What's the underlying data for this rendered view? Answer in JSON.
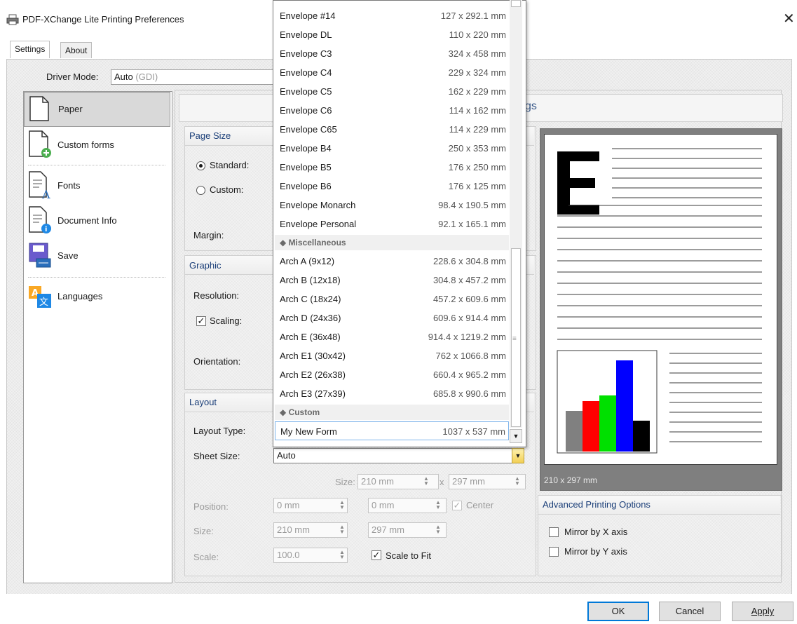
{
  "window": {
    "title": "PDF-XChange Lite Printing Preferences",
    "close": "✕"
  },
  "tabs": [
    "Settings",
    "About"
  ],
  "driver_mode": {
    "label": "Driver Mode:",
    "value": "Auto",
    "value_suffix": "(GDI)"
  },
  "sidebar": {
    "items": [
      {
        "label": "Paper",
        "icon": "paper-icon"
      },
      {
        "label": "Custom forms",
        "icon": "custom-forms-icon"
      },
      {
        "label": "Fonts",
        "icon": "fonts-icon"
      },
      {
        "label": "Document Info",
        "icon": "document-info-icon"
      },
      {
        "label": "Save",
        "icon": "save-icon"
      },
      {
        "label": "Languages",
        "icon": "languages-icon"
      }
    ]
  },
  "header_tail": "gs",
  "page_size": {
    "title": "Page Size",
    "standard_label": "Standard:",
    "custom_label": "Custom:",
    "margin_label": "Margin:"
  },
  "graphic": {
    "title": "Graphic",
    "resolution_label": "Resolution:",
    "scaling_label": "Scaling:",
    "orientation_label": "Orientation:"
  },
  "layout": {
    "title": "Layout",
    "layout_type_label": "Layout Type:",
    "sheet_size_label": "Sheet Size:",
    "sheet_size_value": "Auto",
    "size_label": "Size:",
    "size_w": "210 mm",
    "size_x": "x",
    "size_h": "297 mm",
    "position_label": "Position:",
    "position_x": "0 mm",
    "position_y": "0 mm",
    "center_label": "Center",
    "size2_label": "Size:",
    "size2_w": "210 mm",
    "size2_h": "297 mm",
    "scale_label": "Scale:",
    "scale_value": "100.0",
    "scale_to_fit_label": "Scale to Fit"
  },
  "preview": {
    "caption": "210 x 297 mm"
  },
  "advanced": {
    "title": "Advanced Printing Options",
    "mirror_x": "Mirror by X axis",
    "mirror_y": "Mirror by Y axis"
  },
  "buttons": {
    "ok": "OK",
    "cancel": "Cancel",
    "apply": "Apply"
  },
  "dropdown": {
    "items_top": [
      {
        "name": "Envelope #14",
        "size": "127 x 292.1 mm"
      },
      {
        "name": "Envelope DL",
        "size": "110 x 220 mm"
      },
      {
        "name": "Envelope C3",
        "size": "324 x 458 mm"
      },
      {
        "name": "Envelope C4",
        "size": "229 x 324 mm"
      },
      {
        "name": "Envelope C5",
        "size": "162 x 229 mm"
      },
      {
        "name": "Envelope C6",
        "size": "114 x 162 mm"
      },
      {
        "name": "Envelope C65",
        "size": "114 x 229 mm"
      },
      {
        "name": "Envelope B4",
        "size": "250 x 353 mm"
      },
      {
        "name": "Envelope B5",
        "size": "176 x 250 mm"
      },
      {
        "name": "Envelope B6",
        "size": "176 x 125 mm"
      },
      {
        "name": "Envelope Monarch",
        "size": "98.4 x 190.5 mm"
      },
      {
        "name": "Envelope Personal",
        "size": "92.1 x 165.1 mm"
      }
    ],
    "group_misc": "◆ Miscellaneous",
    "items_misc": [
      {
        "name": "Arch A (9x12)",
        "size": "228.6 x 304.8 mm"
      },
      {
        "name": "Arch B (12x18)",
        "size": "304.8 x 457.2 mm"
      },
      {
        "name": "Arch C (18x24)",
        "size": "457.2 x 609.6 mm"
      },
      {
        "name": "Arch D (24x36)",
        "size": "609.6 x 914.4 mm"
      },
      {
        "name": "Arch E (36x48)",
        "size": "914.4 x 1219.2 mm"
      },
      {
        "name": "Arch E1 (30x42)",
        "size": "762 x 1066.8 mm"
      },
      {
        "name": "Arch E2 (26x38)",
        "size": "660.4 x 965.2 mm"
      },
      {
        "name": "Arch E3 (27x39)",
        "size": "685.8 x 990.6 mm"
      }
    ],
    "group_custom": "◆ Custom",
    "selected": {
      "name": "My New Form",
      "size": "1037 x 537 mm"
    }
  }
}
